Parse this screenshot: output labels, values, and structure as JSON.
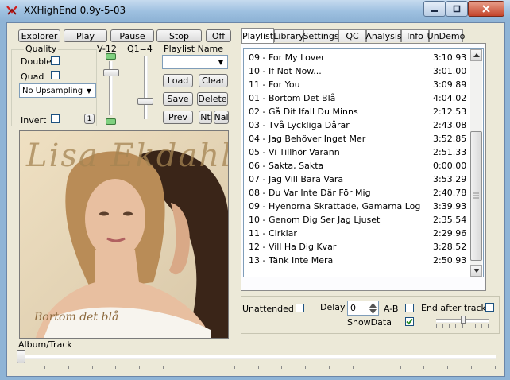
{
  "window": {
    "title": "XXHighEnd 0.9y-5-03"
  },
  "toolbar": {
    "explorer": "Explorer",
    "play": "Play",
    "pause": "Pause",
    "stop": "Stop",
    "off": "Off"
  },
  "quality": {
    "title": "Quality",
    "double_label": "Double",
    "double_checked": false,
    "quad_label": "Quad",
    "quad_checked": false,
    "upsampling_value": "No Upsampling",
    "invert_label": "Invert",
    "invert_checked": false,
    "v12_label": "V-12",
    "q1_label": "Q1=4",
    "small_button": "1"
  },
  "playlist_controls": {
    "name_label": "Playlist Name",
    "name_value": "",
    "load": "Load",
    "clear": "Clear",
    "save": "Save",
    "delete": "Delete",
    "prev": "Prev",
    "nt": "Nt",
    "nal": "Nal"
  },
  "album_art": {
    "artist_script": "Lisa Ekdahl",
    "album_script": "Bortom det blå",
    "colors": {
      "background": "#efe0c2",
      "hair": "#3a2518",
      "skin": "#e8bfa0"
    }
  },
  "tabs": [
    "Playlist",
    "Library",
    "Settings",
    "QC",
    "Analysis",
    "Info",
    "UnDemo"
  ],
  "active_tab": "Playlist",
  "playlist": [
    {
      "name": "09 - For My Lover",
      "time": "3:10.93"
    },
    {
      "name": "10 - If Not Now...",
      "time": "3:01.00"
    },
    {
      "name": "11 - For You",
      "time": "3:09.89"
    },
    {
      "name": "01 - Bortom Det Blå",
      "time": "4:04.02"
    },
    {
      "name": "02 - Gå Dit Ifall Du Minns",
      "time": "2:12.53"
    },
    {
      "name": "03 - Två Lyckliga Dårar",
      "time": "2:43.08"
    },
    {
      "name": "04 - Jag Behöver Inget Mer",
      "time": "3:52.85"
    },
    {
      "name": "05 - Vi Tillhör Varann",
      "time": "2:51.33"
    },
    {
      "name": "06 - Sakta, Sakta",
      "time": "0:00.00"
    },
    {
      "name": "07 - Jag Vill Bara Vara",
      "time": "3:53.29"
    },
    {
      "name": "08 - Du Var Inte Där För Mig",
      "time": "2:40.78"
    },
    {
      "name": "09 - Hyenorna Skrattade, Gamarna Log",
      "time": "3:39.93"
    },
    {
      "name": "10 - Genom Dig Ser Jag Ljuset",
      "time": "2:35.54"
    },
    {
      "name": "11 - Cirklar",
      "time": "2:29.96"
    },
    {
      "name": "12 - Vill Ha Dig Kvar",
      "time": "3:28.52"
    },
    {
      "name": "13 - Tänk Inte Mera",
      "time": "2:50.93"
    }
  ],
  "bottom": {
    "unattended_label": "Unattended",
    "unattended_checked": false,
    "delay_label": "Delay",
    "delay_value": "0",
    "ab_label": "A-B",
    "ab_checked": false,
    "showdata_label": "ShowData",
    "showdata_checked": true,
    "end_after_track_label": "End after track",
    "end_after_track_checked": false
  },
  "progress": {
    "label": "Album/Track",
    "position_fraction": 0.0
  }
}
